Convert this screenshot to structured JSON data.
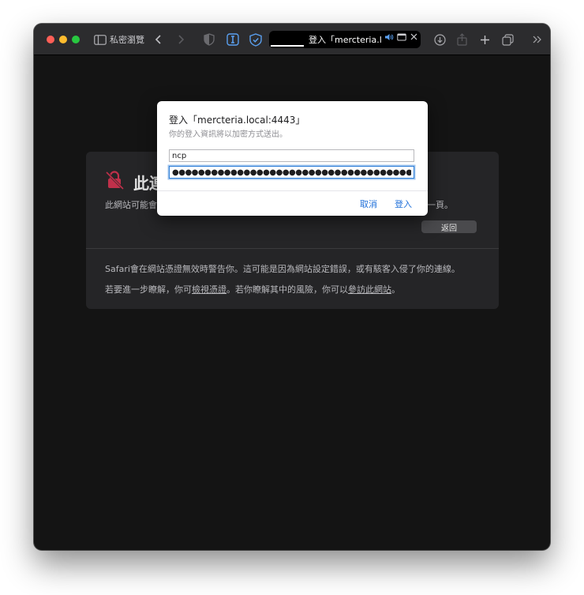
{
  "toolbar": {
    "sidebar_label": "私密瀏覽",
    "tab_title": "登入「mercteria.l...",
    "nav_back_icon": "chevron-left-icon",
    "nav_forward_icon": "chevron-right-icon"
  },
  "error_page": {
    "title": "此連",
    "body_start": "此網站可能會",
    "body_end": "一頁。",
    "back_button": "返回",
    "info_line1": "Safari會在網站憑證無效時警告你。這可能是因為網站設定錯誤，或有駭客入侵了你的連線。",
    "info_line2_a": "若要進一步瞭解，你可",
    "info_link1": "檢視憑證",
    "info_line2_b": "。若你瞭解其中的風險，你可以",
    "info_link2": "參訪此網站",
    "info_line2_c": "。"
  },
  "login_dialog": {
    "title": "登入「mercteria.local:4443」",
    "subtitle": "你的登入資訊將以加密方式送出。",
    "username_value": "ncp",
    "password_value": "●●●●●●●●●●●●●●●●●●●●●●●●●●●●●●●●●●●●●●●●●●●●",
    "cancel_label": "取消",
    "login_label": "登入"
  },
  "colors": {
    "accent": "#1e6fd9",
    "window_bg": "#141414",
    "toolbar_bg": "#2c2c2e"
  }
}
